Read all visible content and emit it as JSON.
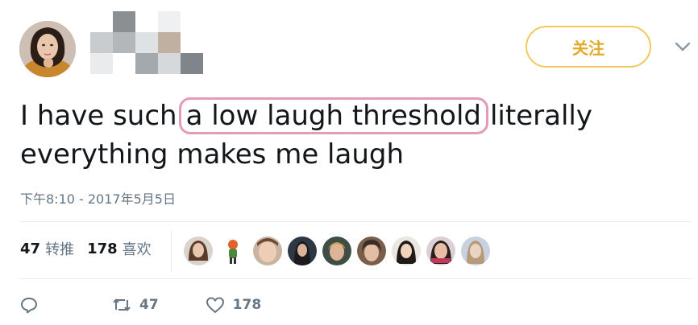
{
  "author": {
    "avatar_alt": "profile photo"
  },
  "follow_button": {
    "label": "关注"
  },
  "tweet": {
    "text_before": "I have such",
    "text_highlight": "a low laugh threshold",
    "text_after_line1": "literally",
    "text_line2": "everything makes me laugh",
    "timestamp": "下午8:10 - 2017年5月5日"
  },
  "stats": {
    "retweets_count": "47",
    "retweets_label": "转推",
    "likes_count": "178",
    "likes_label": "喜欢"
  },
  "actions": {
    "retweet_count": "47",
    "like_count": "178"
  },
  "colors": {
    "follow_border": "#f2c95a",
    "follow_text": "#e4a92a",
    "highlight_border": "#e59ab8",
    "muted": "#657786"
  }
}
